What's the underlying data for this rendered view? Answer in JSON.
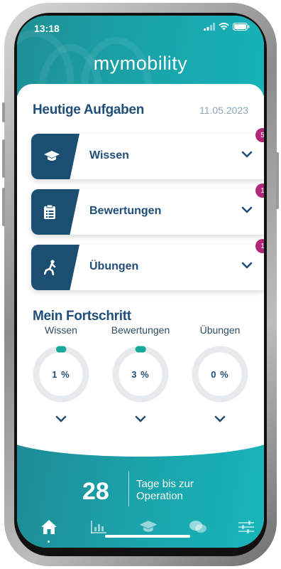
{
  "status_bar": {
    "time": "13:18"
  },
  "header": {
    "brand": "mymobility"
  },
  "tasks": {
    "title": "Heutige Aufgaben",
    "date": "11.05.2023",
    "items": [
      {
        "label": "Wissen",
        "badge": "5",
        "icon": "graduation-cap-icon"
      },
      {
        "label": "Bewertungen",
        "badge": "1",
        "icon": "clipboard-icon"
      },
      {
        "label": "Übungen",
        "badge": "1",
        "icon": "exercise-lunge-icon"
      }
    ]
  },
  "progress": {
    "title": "Mein Fortschritt",
    "items": [
      {
        "label": "Wissen",
        "value_text": "1 %",
        "value": 1
      },
      {
        "label": "Bewertungen",
        "value_text": "3 %",
        "value": 3
      },
      {
        "label": "Übungen",
        "value_text": "0 %",
        "value": 0
      }
    ]
  },
  "countdown": {
    "days": "28",
    "text": "Tage bis zur Operation"
  },
  "nav": {
    "items": [
      "home-icon",
      "chart-icon",
      "graduation-cap-icon",
      "chat-icon",
      "settings-sliders-icon"
    ],
    "active": 0
  },
  "colors": {
    "teal": "#1aa3ab",
    "navy": "#1f4e79",
    "badge": "#b0287a",
    "ring": "#e6eaec",
    "ring_fill": "#17a89c"
  }
}
